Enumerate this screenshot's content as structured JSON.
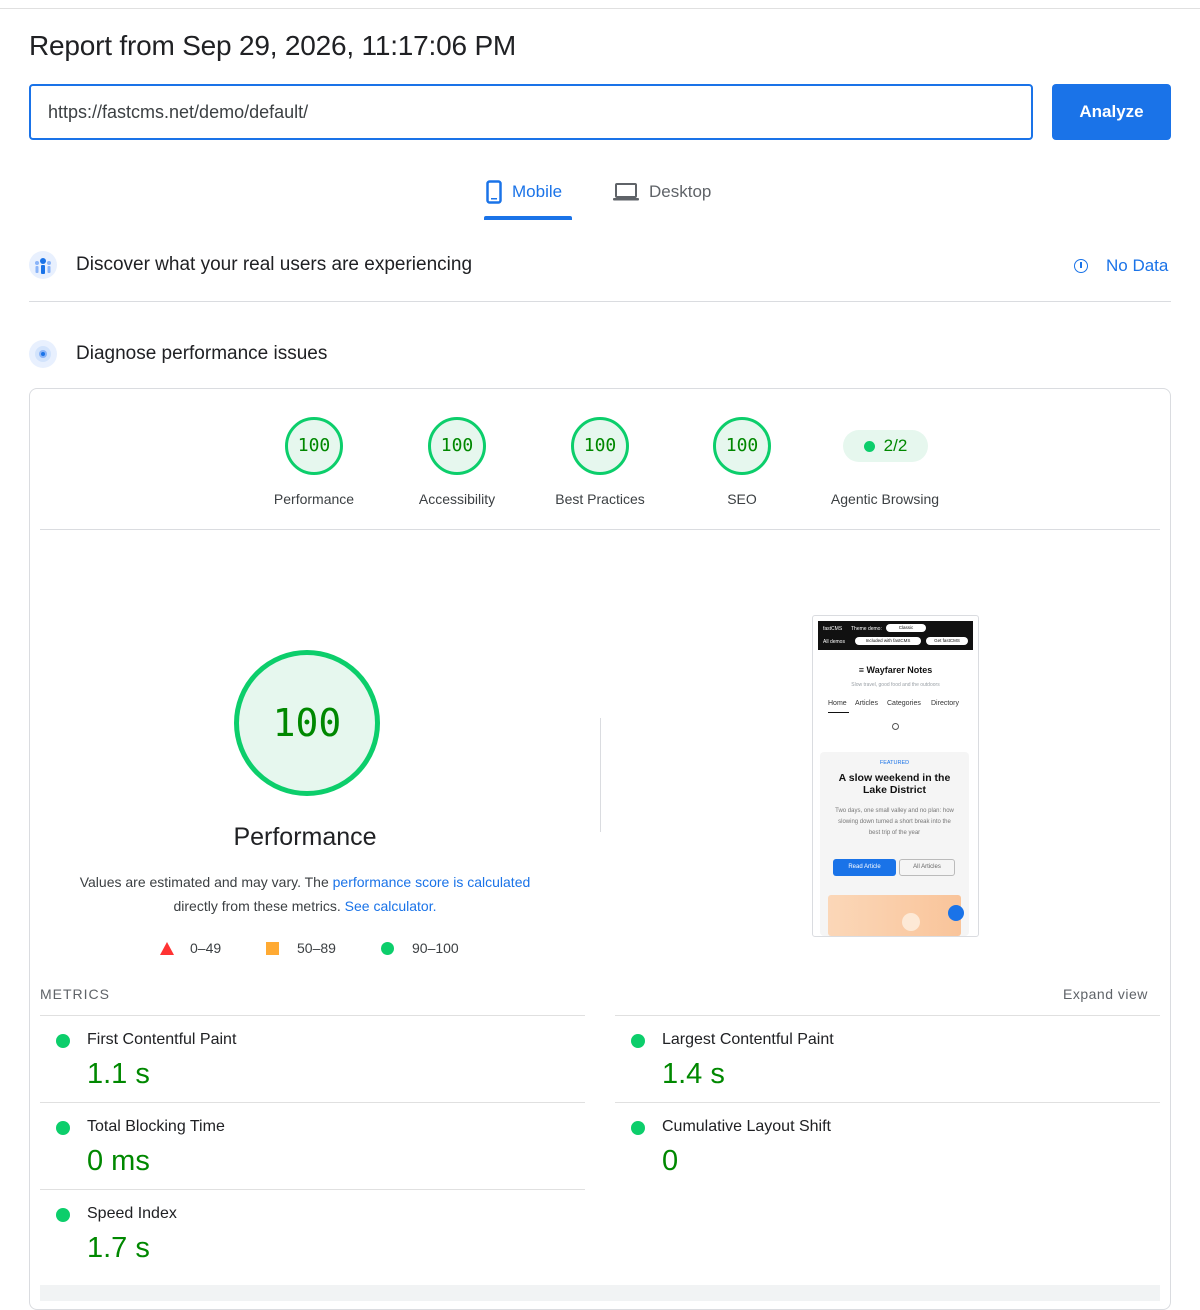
{
  "header": {
    "title": "Report from Sep 29, 2026, 11:17:06 PM"
  },
  "url_input": {
    "value": "https://fastcms.net/demo/default/"
  },
  "analyze_label": "Analyze",
  "tabs": [
    {
      "label": "Mobile",
      "selected": true
    },
    {
      "label": "Desktop",
      "selected": false
    }
  ],
  "field_data": {
    "title": "Discover what your real users are experiencing",
    "status": "No Data"
  },
  "diagnose": {
    "title": "Diagnose performance issues"
  },
  "categories": [
    {
      "score": "100",
      "label": "Performance"
    },
    {
      "score": "100",
      "label": "Accessibility"
    },
    {
      "score": "100",
      "label": "Best Practices"
    },
    {
      "score": "100",
      "label": "SEO"
    },
    {
      "score": "2/2",
      "label": "Agentic Browsing"
    }
  ],
  "perf": {
    "score": "100",
    "title": "Performance",
    "desc_1": "Values are estimated and may vary. The ",
    "desc_link_1": "performance score is calculated",
    "desc_2": "directly from these metrics. ",
    "desc_link_2": "See calculator."
  },
  "legend": {
    "fail": "0–49",
    "average": "50–89",
    "pass": "90–100"
  },
  "screenshot": {
    "top_brand": "fastCMS",
    "top_theme": "Theme demo:",
    "top_select": "Classic",
    "top_all": "All demos",
    "top_included": "Included with fastCMS",
    "top_get": "Get fastCMS",
    "site_name": "Wayfarer Notes",
    "tagline": "Slow travel, good food and the outdoors",
    "nav": [
      "Home",
      "Articles",
      "Categories",
      "Directory"
    ],
    "featured_label": "FEATURED",
    "headline": "A slow weekend in the Lake District",
    "excerpt": "Two days, one small valley and no plan: how slowing down turned a short break into the best trip of the year",
    "btn_primary": "Read Article",
    "btn_secondary": "All Articles"
  },
  "metrics": {
    "heading": "METRICS",
    "expand": "Expand view",
    "items": [
      {
        "name": "First Contentful Paint",
        "value": "1.1 s"
      },
      {
        "name": "Largest Contentful Paint",
        "value": "1.4 s"
      },
      {
        "name": "Total Blocking Time",
        "value": "0 ms"
      },
      {
        "name": "Cumulative Layout Shift",
        "value": "0"
      },
      {
        "name": "Speed Index",
        "value": "1.7 s"
      }
    ]
  },
  "colors": {
    "accent": "#1a73e8",
    "pass": "#0cce6b",
    "pass_text": "#008800",
    "average": "#ffaa33",
    "fail": "#ff3333"
  }
}
